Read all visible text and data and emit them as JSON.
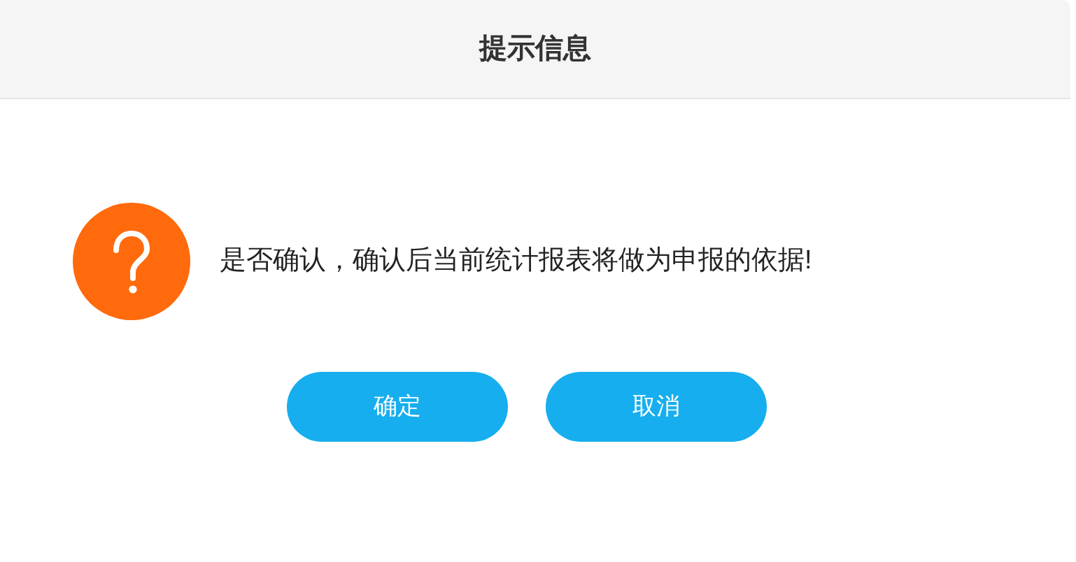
{
  "dialog": {
    "title": "提示信息",
    "message": "是否确认，确认后当前统计报表将做为申报的依据!",
    "buttons": [
      "确定",
      "取消"
    ]
  }
}
